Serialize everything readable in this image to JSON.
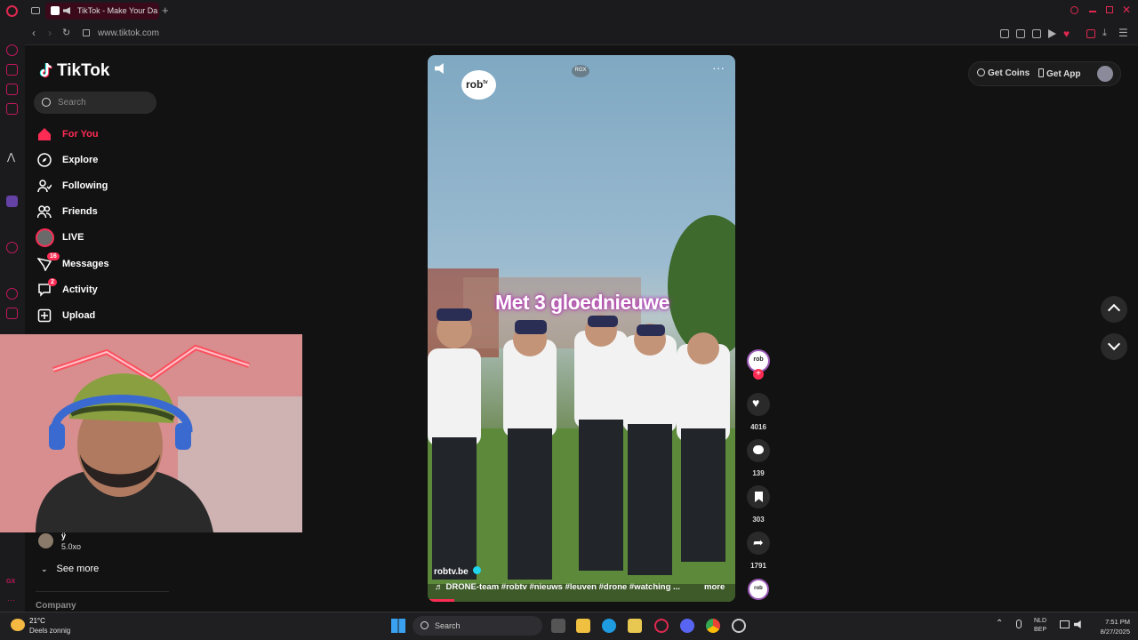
{
  "browser": {
    "tab_title": "TikTok - Make Your Da",
    "url": "www.tiktok.com"
  },
  "sidebar": {
    "brand": "TikTok",
    "search_placeholder": "Search",
    "nav": [
      {
        "label": "For You",
        "icon": "home-icon",
        "active": true
      },
      {
        "label": "Explore",
        "icon": "compass-icon"
      },
      {
        "label": "Following",
        "icon": "following-icon"
      },
      {
        "label": "Friends",
        "icon": "friends-icon"
      },
      {
        "label": "LIVE",
        "icon": "live-icon"
      },
      {
        "label": "Messages",
        "icon": "messages-icon",
        "badge": "16"
      },
      {
        "label": "Activity",
        "icon": "activity-icon",
        "badge": "2"
      },
      {
        "label": "Upload",
        "icon": "upload-icon"
      }
    ],
    "following_account": {
      "name": "ÿ",
      "handle": "5.0xo"
    },
    "see_more": "See more",
    "footer_section": "Company"
  },
  "header_actions": {
    "get_coins": "Get Coins",
    "get_app": "Get App"
  },
  "video": {
    "watermark": "rob",
    "watermark_sup": "tv",
    "badge": "RGX",
    "caption_overlay": "Met 3 gloednieuwe",
    "author": "robtv.be",
    "description": "DRONE-team #robtv #nieuws #leuven #drone #watching ...",
    "more": "more"
  },
  "actions": {
    "likes": "4016",
    "comments": "139",
    "saves": "303",
    "shares": "1791"
  },
  "taskbar": {
    "weather_temp": "21°C",
    "weather_desc": "Deels zonnig",
    "search": "Search",
    "lang": "NLD",
    "lang2": "BEP",
    "time": "7:51 PM",
    "date": "8/27/2025"
  },
  "colors": {
    "accent": "#fe2c55",
    "opera": "#c2185b",
    "background": "#121212"
  }
}
